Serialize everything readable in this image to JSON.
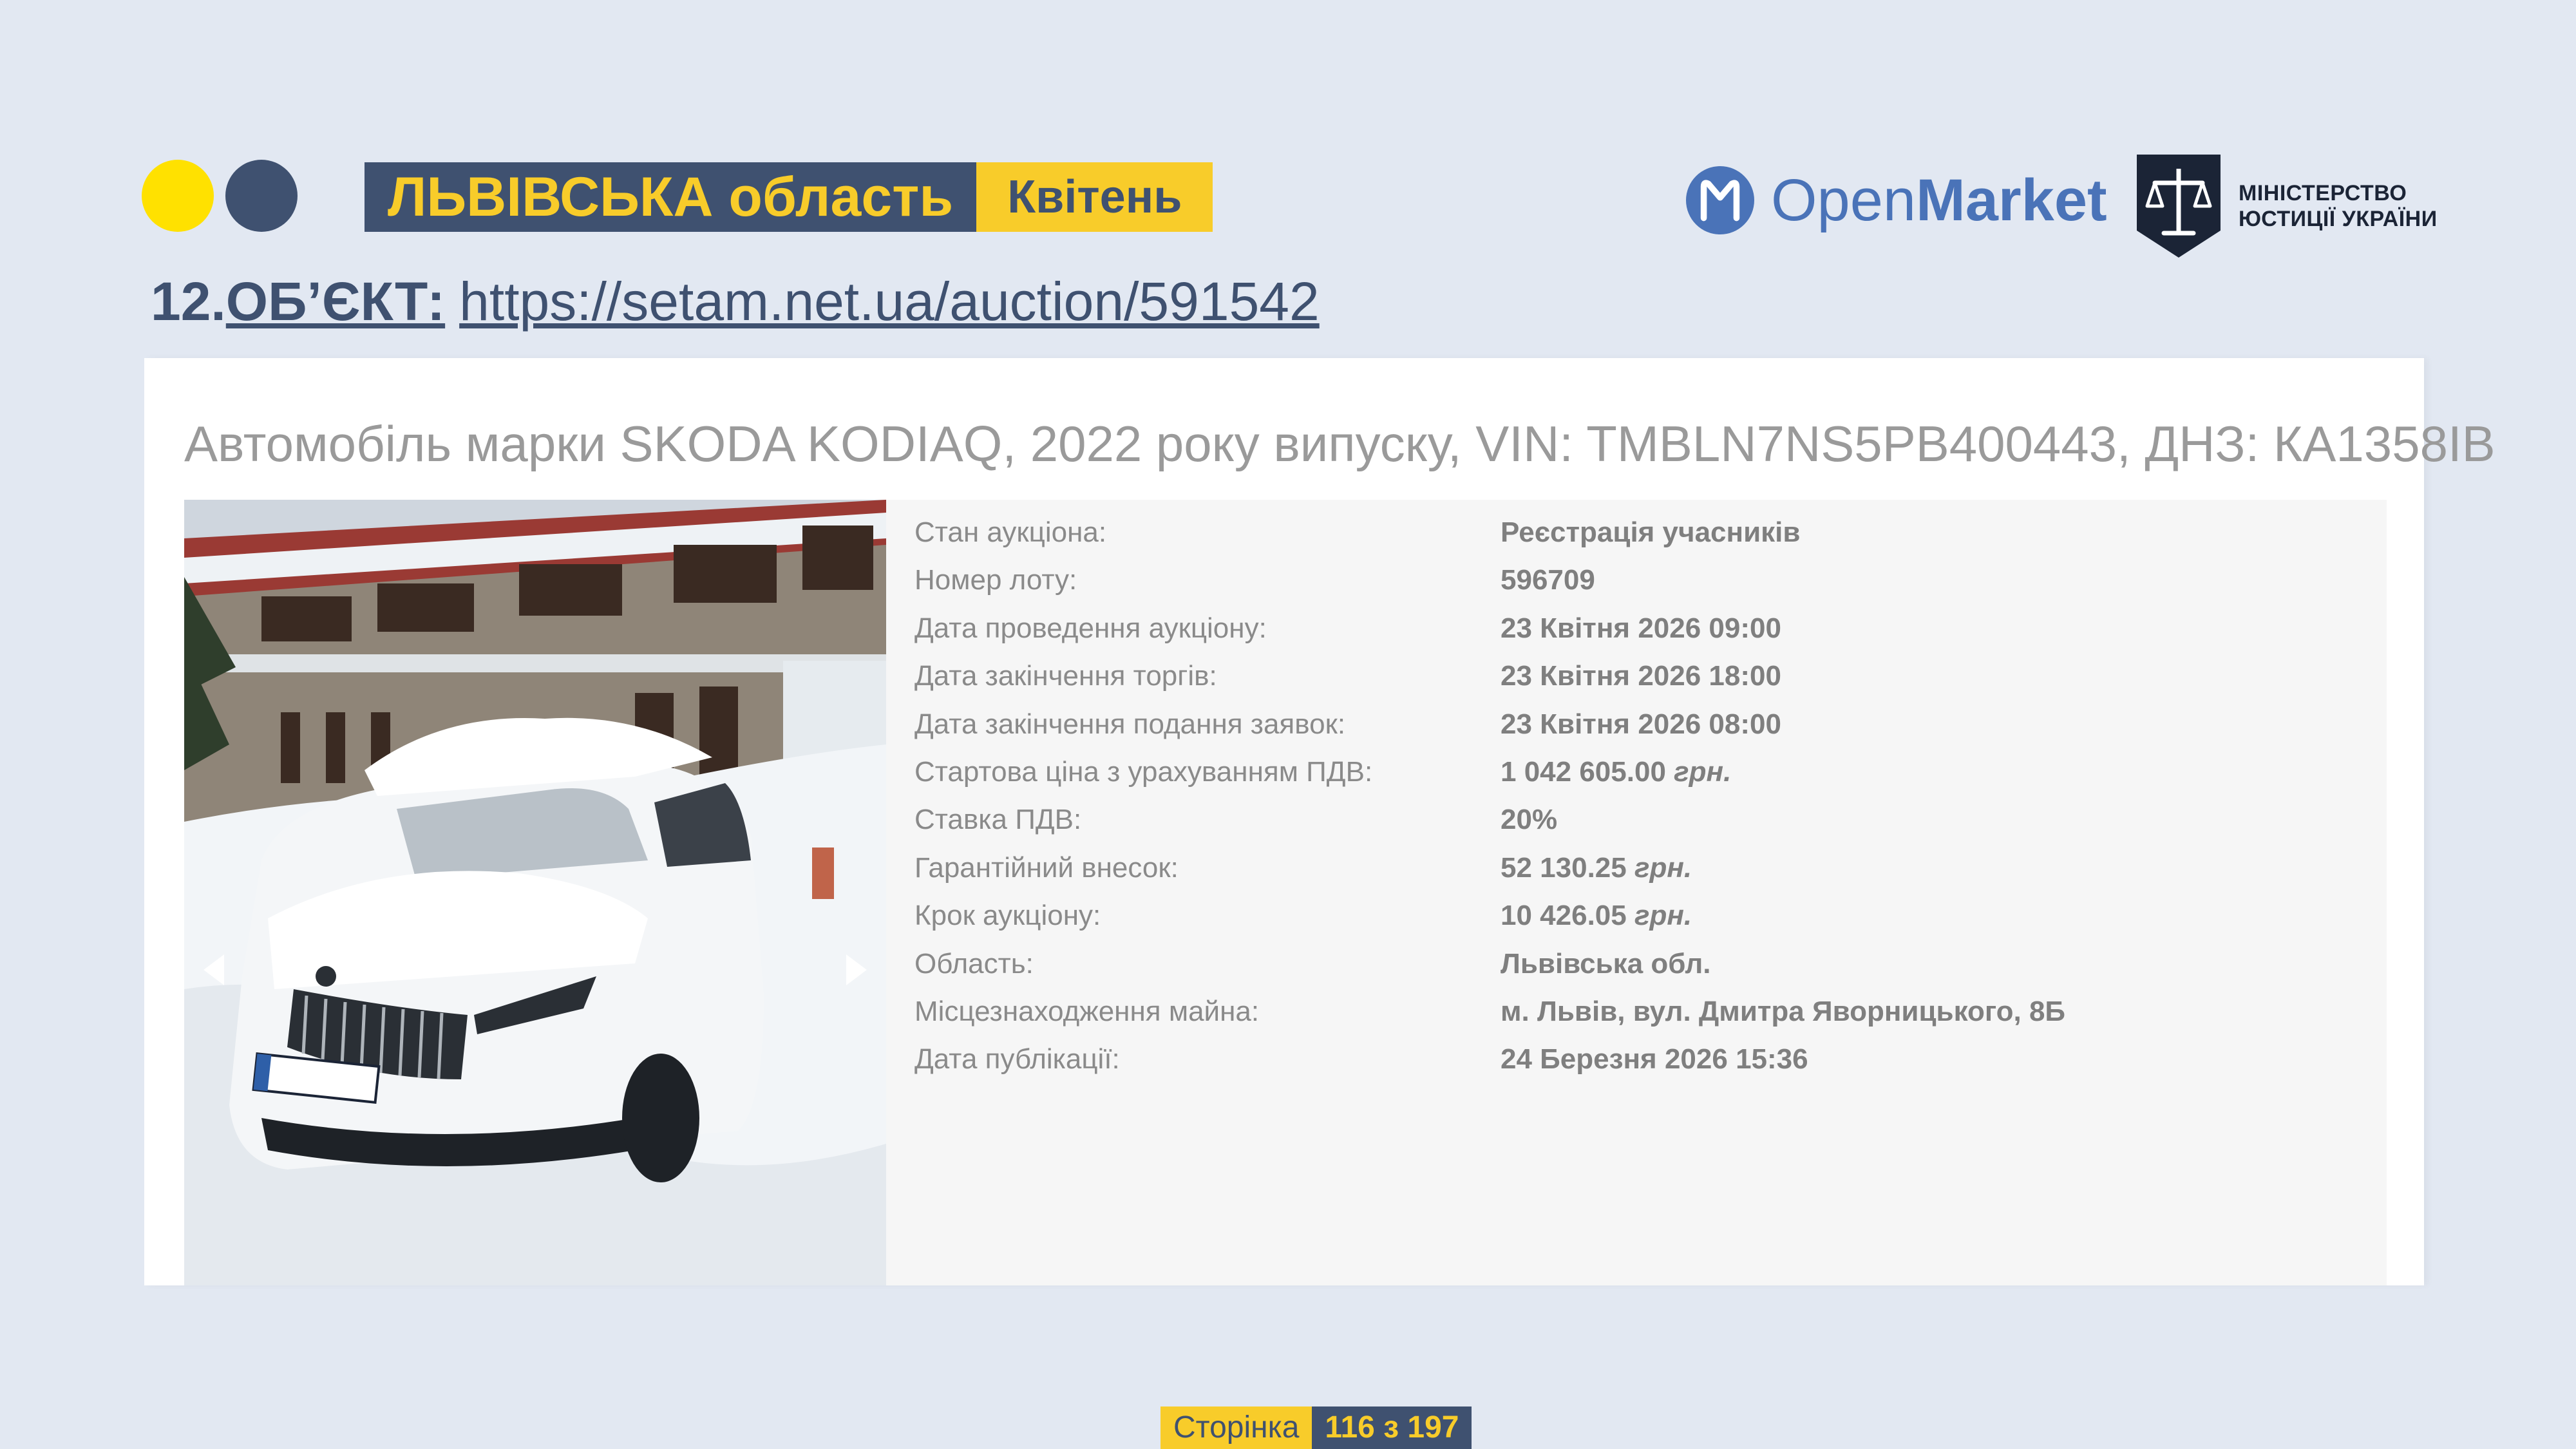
{
  "header": {
    "region": "ЛЬВІВСЬКА область",
    "month": "Квітень",
    "openmarket_open": "Open",
    "openmarket_market": "Market",
    "ministry_line1": "МІНІСТЕРСТВО",
    "ministry_line2": "ЮСТИЦІЇ УКРАЇНИ"
  },
  "object": {
    "number": "12.",
    "label": "ОБ’ЄКТ:",
    "url": "https://setam.net.ua/auction/591542"
  },
  "lot": {
    "title": "Автомобіль марки SKODA KODIAQ, 2022 року випуску, VIN: TMBLN7NS5PB400443, ДНЗ: КА1358ІВ",
    "plate": "KA 1358 IB",
    "details": [
      {
        "label": "Стан аукціона:",
        "value": "Реєстрація учасників",
        "unit": ""
      },
      {
        "label": "Номер лоту:",
        "value": "596709",
        "unit": ""
      },
      {
        "label": "Дата проведення аукціону:",
        "value": "23 Квітня 2026 09:00",
        "unit": ""
      },
      {
        "label": "Дата закінчення торгів:",
        "value": "23 Квітня 2026 18:00",
        "unit": ""
      },
      {
        "label": "Дата закінчення подання заявок:",
        "value": "23 Квітня 2026 08:00",
        "unit": ""
      },
      {
        "label": "Стартова ціна з урахуванням ПДВ:",
        "value": "1 042 605.00",
        "unit": "грн."
      },
      {
        "label": "Ставка ПДВ:",
        "value": "20%",
        "unit": ""
      },
      {
        "label": "Гарантійний внесок:",
        "value": "52 130.25",
        "unit": "грн."
      },
      {
        "label": "Крок аукціону:",
        "value": "10 426.05",
        "unit": "грн."
      },
      {
        "label": "Область:",
        "value": "Львівська обл.",
        "unit": ""
      },
      {
        "label": "Місцезнаходження майна:",
        "value": "м. Львів, вул. Дмитра Яворницького, 8Б",
        "unit": ""
      },
      {
        "label": "Дата публікації:",
        "value": "24 Березня 2026 15:36",
        "unit": ""
      }
    ]
  },
  "footer": {
    "page_label": "Сторінка",
    "page_number": "116 з 197"
  },
  "colors": {
    "background": "#e2e8f2",
    "navy": "#3f5170",
    "yellow": "#f8cc2a",
    "dot_yellow": "#ffe100",
    "openmarket_blue": "#4a73b8"
  }
}
